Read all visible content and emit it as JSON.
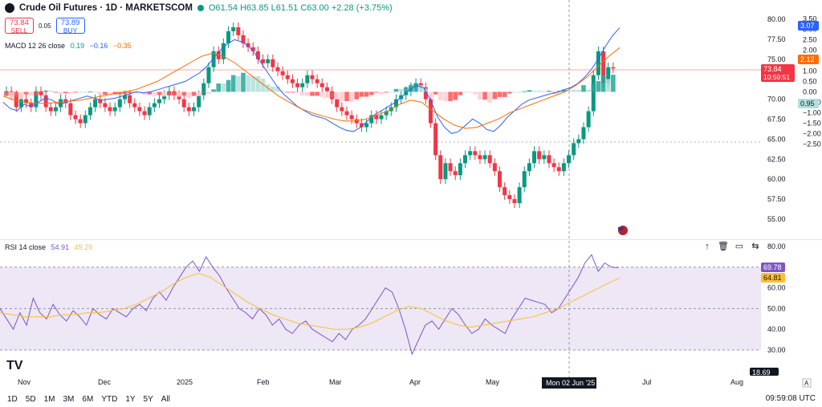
{
  "header": {
    "title": "Crude Oil Futures · 1D · MARKETSCOM",
    "ohlc": "O61.54 H63.85 L61.51 C63.00 +2.28 (+3.75%)",
    "sell_price": "73.84",
    "sell_label": "SELL",
    "spread": "0.05",
    "buy_price": "73.89",
    "buy_label": "BUY"
  },
  "macd_label": {
    "name": "MACD 12 26 close",
    "v1": "0.19",
    "v2": "−0.16",
    "v3": "−0.35"
  },
  "rsi_label": {
    "name": "RSI 14 close",
    "v1": "54.91",
    "v2": "49.29"
  },
  "price_axis": [
    "80.00",
    "77.50",
    "75.00",
    "72.50",
    "70.00",
    "67.50",
    "65.00",
    "62.50",
    "60.00",
    "57.50",
    "55.00"
  ],
  "macd_axis": [
    "3.50",
    "3.00",
    "2.50",
    "2.00",
    "1.50",
    "1.00",
    "0.50",
    "0.00",
    "−0.50",
    "−1.00",
    "−1.50",
    "−2.00",
    "−2.50"
  ],
  "rsi_axis": [
    "80.00",
    "70.00",
    "60.00",
    "50.00",
    "40.00",
    "30.00"
  ],
  "price_badge": {
    "price": "73.84",
    "countdown": "10:59:51"
  },
  "badges": {
    "macd_blue": "3.07",
    "macd_orange": "2.12",
    "macd_hist": "0.95",
    "rsi": "69.78",
    "rsi_ma": "64.81",
    "cut": "18.69"
  },
  "x_axis": [
    "Nov",
    "Dec",
    "2025",
    "Feb",
    "Mar",
    "Apr",
    "May",
    "Jul",
    "Aug"
  ],
  "crosshair_date": "Mon 02 Jun '25",
  "timeframes": [
    "1D",
    "5D",
    "1M",
    "3M",
    "6M",
    "YTD",
    "1Y",
    "5Y",
    "All"
  ],
  "clock": "09:59:08 UTC",
  "logo": "TV",
  "colors": {
    "up": "#089981",
    "down": "#f23645",
    "macd": "#2962ff",
    "signal": "#ff6d00",
    "rsi": "#7e57c2",
    "rsima": "#fbc02d",
    "rsi_band": "#ede7f6"
  },
  "chart_data": [
    {
      "type": "candlestick",
      "title": "Crude Oil Futures · 1D · MARKETSCOM",
      "ylim": [
        55,
        80
      ],
      "close": [
        71,
        70.5,
        69,
        70,
        69.5,
        69,
        71,
        70.5,
        69,
        68.5,
        69,
        70,
        69.5,
        68,
        67.5,
        67,
        68,
        69,
        70,
        69.5,
        69,
        68.5,
        69,
        70,
        70.5,
        69.5,
        69,
        68.5,
        68,
        69,
        69.5,
        70,
        70.5,
        71,
        70.5,
        70,
        69,
        68.5,
        69,
        70.5,
        72,
        74,
        76,
        75,
        77,
        78.5,
        79,
        78,
        77,
        76.5,
        76,
        75,
        74.5,
        75,
        74,
        73.5,
        73,
        72.5,
        72,
        71.5,
        72,
        73,
        72.5,
        72,
        71.5,
        71,
        70,
        69,
        68.5,
        68,
        67.5,
        67,
        66.5,
        67,
        68,
        67.5,
        68,
        68.5,
        69,
        70,
        70.5,
        71,
        71.5,
        72,
        71.5,
        70,
        67,
        63,
        60,
        62,
        61,
        60.5,
        62,
        63,
        63.5,
        63,
        62.5,
        63,
        62,
        61,
        59,
        58,
        57.5,
        57,
        59,
        61,
        62,
        63.5,
        62.5,
        63,
        62,
        61.5,
        61,
        62,
        63,
        64.5,
        65,
        66.5,
        68.5,
        73,
        76,
        72,
        74,
        73.84
      ],
      "open_offsets": "derived (candle bodies alternate around the close path)",
      "macd": [
        -0.5,
        -0.8,
        -0.9,
        -0.6,
        -0.7,
        -0.5,
        -0.3,
        -0.4,
        -0.6,
        -0.5,
        -0.4,
        -0.3,
        -0.2,
        -0.3,
        -0.4,
        -0.35,
        -0.3,
        -0.2,
        -0.1,
        0,
        -0.05,
        0,
        0.1,
        0.2,
        0.3,
        0.4,
        0.5,
        0.7,
        0.9,
        1.2,
        1.6,
        2.0,
        2.3,
        2.5,
        2.4,
        2.2,
        1.8,
        1.3,
        0.8,
        0.3,
        -0.1,
        -0.4,
        -0.7,
        -0.9,
        -1.1,
        -1.2,
        -1.3,
        -1.5,
        -1.7,
        -1.85,
        -1.9,
        -1.7,
        -1.4,
        -1.1,
        -0.9,
        -0.7,
        -0.5,
        -0.2,
        0.1,
        0.3,
        0.2,
        -0.4,
        -1.2,
        -1.7,
        -2.0,
        -1.9,
        -1.6,
        -1.3,
        -1.5,
        -1.8,
        -1.9,
        -1.6,
        -1.2,
        -0.9,
        -0.6,
        -0.4,
        -0.3,
        -0.2,
        -0.1,
        -0.05,
        0.1,
        0.2,
        0.4,
        0.7,
        1.1,
        1.6,
        2.2,
        2.7,
        3.07
      ],
      "signal": [
        -0.2,
        -0.4,
        -0.5,
        -0.55,
        -0.55,
        -0.5,
        -0.45,
        -0.4,
        -0.3,
        -0.2,
        -0.1,
        0,
        0.1,
        0.3,
        0.5,
        0.8,
        1.1,
        1.4,
        1.7,
        1.85,
        1.7,
        1.4,
        1.0,
        0.6,
        0.2,
        -0.2,
        -0.5,
        -0.8,
        -1.0,
        -1.15,
        -1.3,
        -1.4,
        -1.4,
        -1.3,
        -1.1,
        -0.9,
        -0.6,
        -0.4,
        -0.5,
        -0.9,
        -1.3,
        -1.6,
        -1.75,
        -1.7,
        -1.5,
        -1.3,
        -1.0,
        -0.8,
        -0.6,
        -0.4,
        -0.2,
        0,
        0.3,
        0.7,
        1.2,
        1.7,
        2.12
      ],
      "rsi": [
        50,
        45,
        40,
        48,
        42,
        55,
        48,
        45,
        52,
        47,
        44,
        49,
        46,
        42,
        50,
        47,
        45,
        50,
        48,
        46,
        50,
        52,
        49,
        55,
        58,
        54,
        60,
        65,
        70,
        73,
        68,
        75,
        70,
        66,
        60,
        55,
        50,
        48,
        45,
        50,
        47,
        42,
        45,
        40,
        38,
        42,
        44,
        40,
        38,
        36,
        34,
        38,
        35,
        40,
        42,
        45,
        50,
        55,
        60,
        58,
        50,
        40,
        28,
        35,
        42,
        44,
        40,
        45,
        50,
        47,
        42,
        38,
        40,
        45,
        42,
        40,
        38,
        45,
        50,
        55,
        54,
        53,
        52,
        48,
        50,
        55,
        60,
        65,
        72,
        76,
        68,
        72,
        70,
        69.78
      ],
      "rsi_ma": [
        48,
        47,
        46,
        46,
        46,
        47,
        47,
        48,
        48,
        49,
        50,
        52,
        55,
        58,
        62,
        65,
        67,
        65,
        61,
        57,
        53,
        50,
        47,
        45,
        43,
        42,
        41,
        40,
        40,
        41,
        43,
        46,
        49,
        51,
        50,
        47,
        44,
        42,
        41,
        42,
        43,
        44,
        45,
        46,
        48,
        50,
        53,
        56,
        59,
        62,
        64.81
      ],
      "rsi_ylim": [
        30,
        80
      ],
      "macd_ylim": [
        -2.5,
        3.5
      ]
    }
  ]
}
